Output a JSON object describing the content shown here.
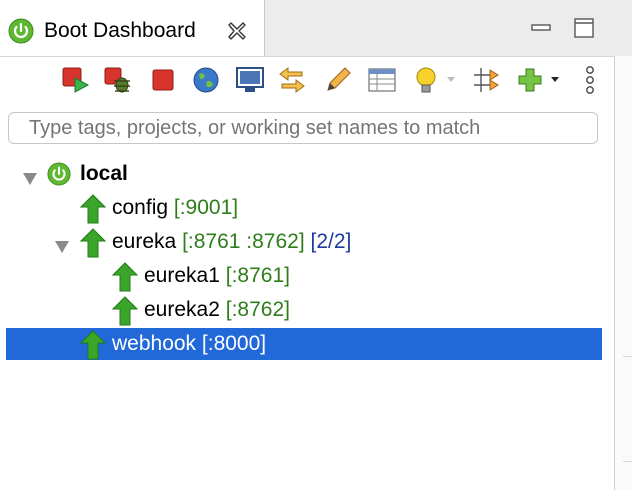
{
  "tab": {
    "title": "Boot Dashboard",
    "icon": "spring-power-icon",
    "close_icon": "close-icon"
  },
  "window_controls": [
    "minimize-icon",
    "maximize-icon"
  ],
  "toolbar": {
    "tools": [
      "restart-icon",
      "debug-restart-icon",
      "stop-icon",
      "open-browser-icon",
      "open-console-icon",
      "open-config-icon",
      "edit-icon",
      "properties-table-icon",
      "lightbulb-icon",
      "filter-arrows-icon",
      "add-icon",
      "more-vertical-icon"
    ]
  },
  "filter": {
    "placeholder": "Type tags, projects, or working set names to match"
  },
  "tree": {
    "root": {
      "label": "local",
      "expanded": true,
      "icon": "spring-power-icon"
    },
    "apps": [
      {
        "name": "config",
        "ports": "[:9001]",
        "status": "running"
      },
      {
        "name": "eureka",
        "ports": "[:8761 :8762]",
        "instances": "[2/2]",
        "status": "running",
        "expanded": true,
        "children": [
          {
            "name": "eureka1",
            "ports": "[:8761]",
            "status": "running"
          },
          {
            "name": "eureka2",
            "ports": "[:8762]",
            "status": "running"
          }
        ]
      },
      {
        "name": "webhook",
        "ports": "[:8000]",
        "status": "running",
        "selected": true
      }
    ]
  },
  "colors": {
    "accent_selection": "#2168d9",
    "running_green": "#3aa629",
    "port_green": "#2e7d1b",
    "instances_blue": "#1f3b9c"
  }
}
